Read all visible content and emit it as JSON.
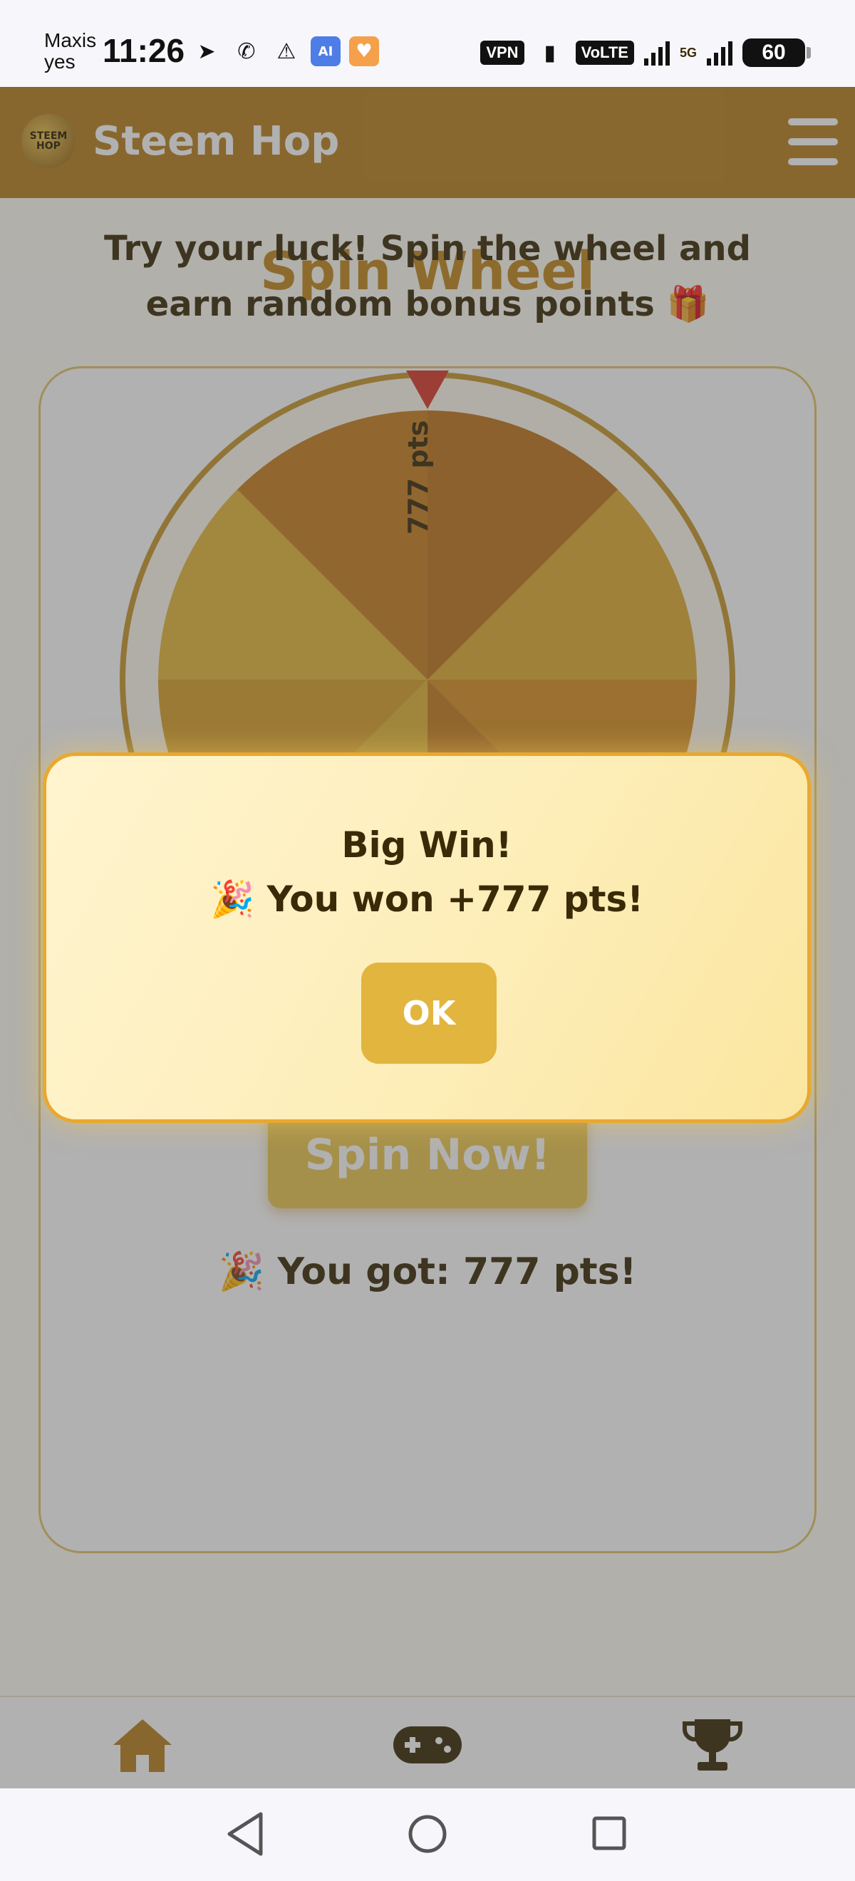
{
  "status_bar": {
    "carrier_line1": "Maxis",
    "carrier_line2": "yes",
    "time": "11:26",
    "vpn": "VPN",
    "volte": "VoLTE",
    "network": "5G",
    "battery": "60"
  },
  "header": {
    "logo_text": "STEEM HOP",
    "brand": "Steem Hop"
  },
  "page": {
    "title": "Spin Wheel",
    "description": "Try your luck! Spin the wheel and earn random bonus points 🎁",
    "wheel_top_label": "777 pts",
    "spin_button": "Spin Now!",
    "result": "🎉 You got: 777 pts!"
  },
  "modal": {
    "title": "Big Win!",
    "message": "🎉 You won +777 pts!",
    "ok_button": "OK"
  },
  "bottom_nav": {
    "items": [
      {
        "icon": "home-icon"
      },
      {
        "icon": "gamepad-icon"
      },
      {
        "icon": "trophy-icon"
      }
    ]
  },
  "colors": {
    "brand": "#b8801f",
    "accent": "#e2b53e",
    "pointer": "#d93a2a"
  }
}
